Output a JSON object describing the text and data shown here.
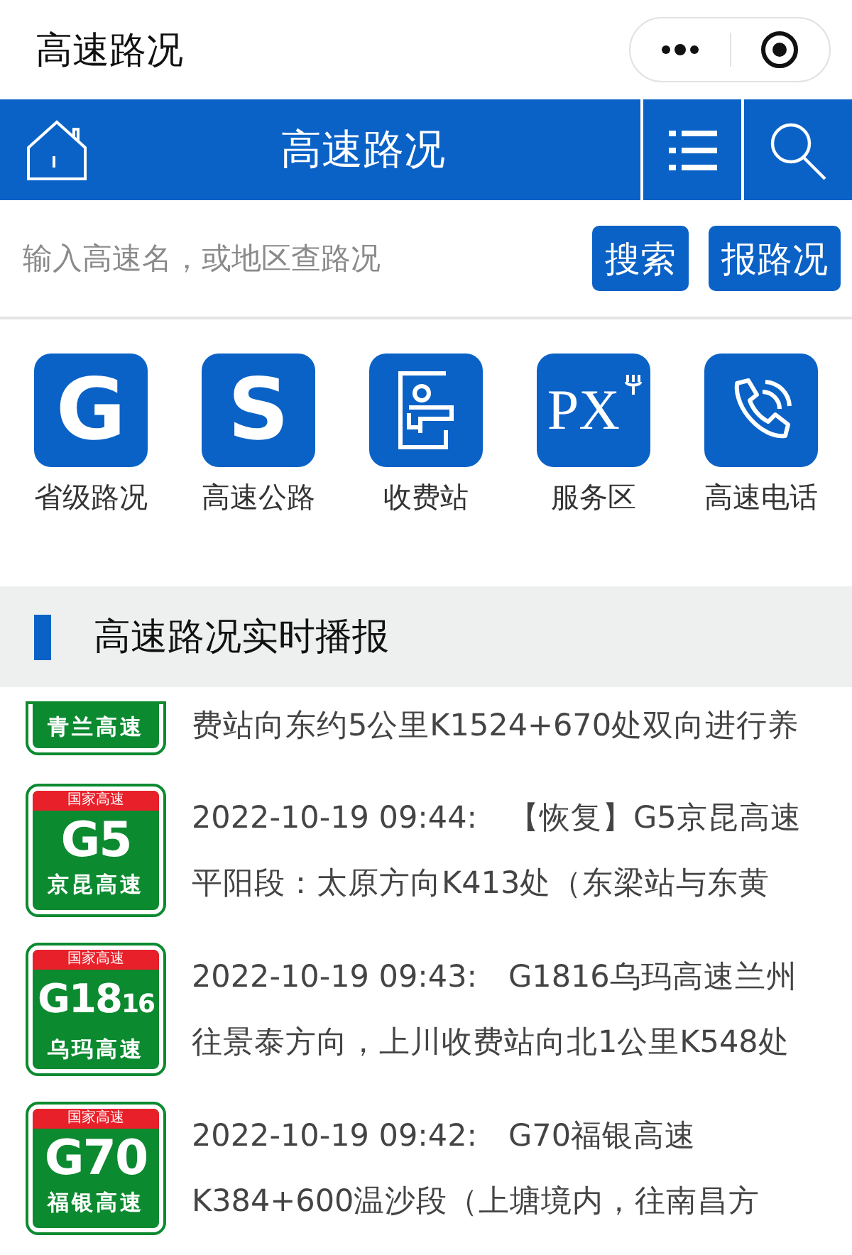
{
  "top_bar": {
    "title": "高速路况"
  },
  "header": {
    "title": "高速路况"
  },
  "search": {
    "placeholder": "输入高速名，或地区查路况",
    "buttons": [
      "搜索",
      "报路况"
    ]
  },
  "shortcuts": [
    {
      "kind": "letter",
      "glyph": "G",
      "label": "省级路况"
    },
    {
      "kind": "letter",
      "glyph": "S",
      "label": "高速公路"
    },
    {
      "kind": "toll",
      "label": "收费站"
    },
    {
      "kind": "service",
      "glyph": "PX",
      "label": "服务区"
    },
    {
      "kind": "phone",
      "label": "高速电话"
    }
  ],
  "section": {
    "title": "高速路况实时播报"
  },
  "news": [
    {
      "partial": true,
      "sign": {
        "name": "青兰高速"
      },
      "lines": [
        "费站向东约5公里K1524+670处双向进行养"
      ]
    },
    {
      "partial": false,
      "sign": {
        "band": "国家高速",
        "code": "G5",
        "name": "京昆高速"
      },
      "lines": [
        "2022-10-19 09:44:　【恢复】G5京昆高速",
        "平阳段：太原方向K413处（东梁站与东黄"
      ]
    },
    {
      "partial": false,
      "sign": {
        "band": "国家高速",
        "code": "G18",
        "code_suffix": "16",
        "name": "乌玛高速"
      },
      "lines": [
        "2022-10-19 09:43:　G1816乌玛高速兰州",
        "往景泰方向，上川收费站向北1公里K548处"
      ]
    },
    {
      "partial": false,
      "sign": {
        "band": "国家高速",
        "code": "G70",
        "name": "福银高速"
      },
      "lines": [
        "2022-10-19 09:42:　G70福银高速",
        "K384+600温沙段（上塘境内，往南昌方"
      ]
    }
  ]
}
